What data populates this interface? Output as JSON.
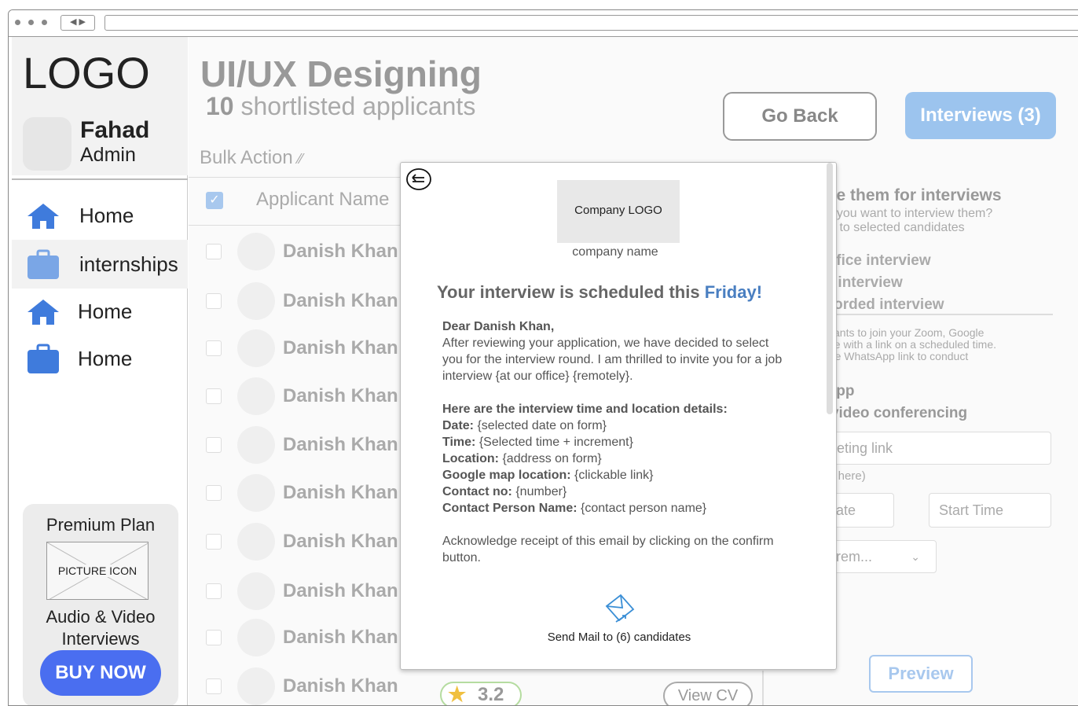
{
  "sidebar": {
    "logo": "LOGO",
    "user": {
      "name": "Fahad",
      "role": "Admin"
    },
    "nav": [
      {
        "label": "Home",
        "icon": "home-icon"
      },
      {
        "label": "internships",
        "icon": "briefcase-icon"
      },
      {
        "label": "Home",
        "icon": "home-icon"
      },
      {
        "label": "Home",
        "icon": "briefcase-icon"
      }
    ],
    "premium": {
      "title": "Premium Plan",
      "picture_label": "PICTURE ICON",
      "subtitle": "Audio & Video Interviews",
      "button": "BUY NOW"
    }
  },
  "header": {
    "title": "UI/UX Designing",
    "count": "10",
    "subtitle_rest": "shortlisted applicants",
    "go_back": "Go Back",
    "interviews": "Interviews (3)",
    "bulk_action": "Bulk Action"
  },
  "table": {
    "header_name": "Applicant Name",
    "rows": [
      "Danish Khan",
      "Danish Khan",
      "Danish Khan",
      "Danish Khan",
      "Danish Khan",
      "Danish Khan",
      "Danish Khan",
      "Danish Khan",
      "Danish Khan",
      "Danish Khan"
    ],
    "last_row_rating": "3.2",
    "last_row_button": "View CV"
  },
  "invite_form": {
    "heading": "vite them for interviews",
    "question": "ow you want to interview them?",
    "question_sub": "ails to selected candidates",
    "options": [
      "-office interview",
      "ve interview",
      "ecorded interview"
    ],
    "note_lines": [
      "plicants to join your Zoom, Google",
      "kype with a link on a scheduled time.",
      "oose WhatsApp link to conduct"
    ],
    "whatsapp": "sApp",
    "video_conf": "d video conferencing",
    "meeting_link_placeholder": "leeting link",
    "link_hint": "link here)",
    "date_placeholder": "Date",
    "time_placeholder": "Start Time",
    "increment_placeholder": "crem...",
    "preview": "Preview"
  },
  "modal": {
    "company_logo": "Company LOGO",
    "company_name": "company name",
    "heading_pre": "Your interview is scheduled this ",
    "heading_day": "Friday",
    "heading_post": "!",
    "greeting": "Dear Danish Khan,",
    "intro": "After reviewing your application, we have decided to select you for the interview round. I am thrilled to invite you for a job interview {at our office} {remotely}.",
    "details_heading": "Here are the interview time and location details:",
    "details": [
      {
        "label": "Date:",
        "value": " {selected date on form}"
      },
      {
        "label": "Time:",
        "value": " {Selected time + increment}"
      },
      {
        "label": "Location:",
        "value": " {address on form}"
      },
      {
        "label": "Google map location:",
        "value": " {clickable link}"
      },
      {
        "label": "Contact no:",
        "value": " {number}"
      },
      {
        "label": "Contact Person Name:",
        "value": " {contact person name}"
      }
    ],
    "closing": "Acknowledge receipt of this email by clicking on the confirm button.",
    "send_label": "Send Mail to (6) candidates"
  },
  "colors": {
    "accent": "#4a6ef0",
    "link_blue": "#4a7fc1",
    "nav_icon": "#3f7bdc",
    "interviews_button": "#9cc4ee"
  }
}
